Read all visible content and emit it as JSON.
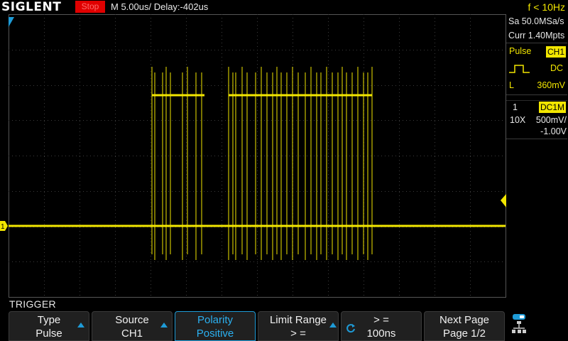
{
  "topbar": {
    "brand": "SIGLENT",
    "run_state": "Stop",
    "timebase": "M 5.00us/  Delay:-402us",
    "trigger_frequency": "f < 10Hz"
  },
  "acquisition": {
    "sample_rate": "Sa 50.0MSa/s",
    "memory_depth": "Curr 1.40Mpts"
  },
  "trigger_panel": {
    "type": "Pulse",
    "source": "CH1",
    "coupling": "DC",
    "mode": "L",
    "level": "360mV"
  },
  "channel_info": {
    "number": "1",
    "coupling": "DC1M",
    "probe": "10X",
    "scale": "500mV/",
    "offset": "-1.00V"
  },
  "marker": {
    "channel_label": "1"
  },
  "menu": {
    "title": "TRIGGER",
    "softkeys": [
      {
        "label": "Type",
        "value": "Pulse"
      },
      {
        "label": "Source",
        "value": "CH1"
      },
      {
        "label": "Polarity",
        "value": "Positive"
      },
      {
        "label": "Limit Range",
        "value": "> ="
      },
      {
        "label": "> =",
        "value": "100ns"
      },
      {
        "label": "Next Page",
        "value": "Page 1/2"
      }
    ]
  },
  "colors": {
    "trace": "#f2e600",
    "accent": "#1e9bd7",
    "stop": "#e00000",
    "grid": "#3c3c3c"
  },
  "icons": {
    "knob": "rotary-knob-icon",
    "network": "network-icon",
    "scroll": "up-arrow-icon"
  }
}
